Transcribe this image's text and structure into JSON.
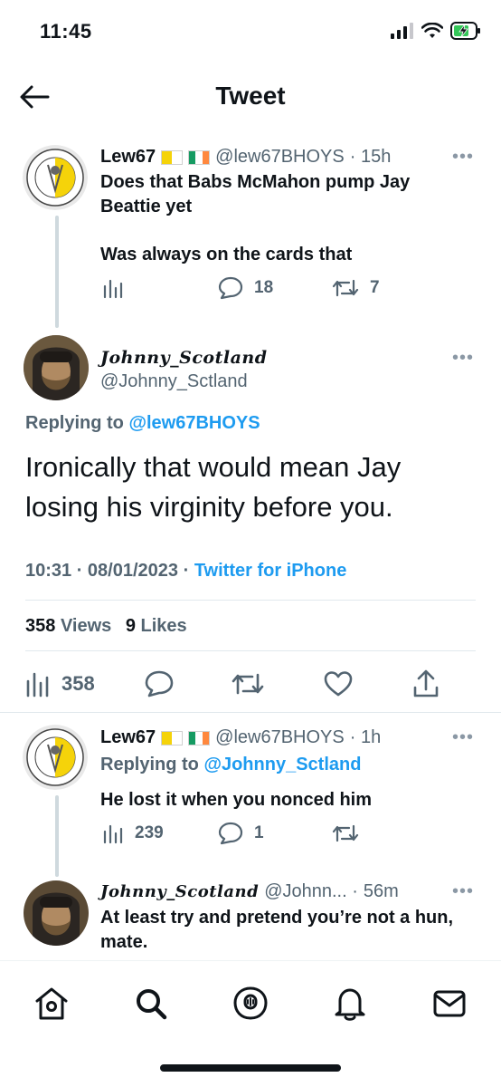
{
  "status_bar": {
    "time": "11:45"
  },
  "nav": {
    "title": "Tweet"
  },
  "parent_tweet": {
    "name": "Lew67",
    "handle": "@lew67BHOYS",
    "time": "· 15h",
    "text_line1": "Does that Babs McMahon pump Jay",
    "text_line2": "Beattie yet",
    "text_line3": "Was always on the cards that",
    "replies": "18",
    "retweets": "7"
  },
  "main_tweet": {
    "name": "Johnny_Scotland",
    "handle": "@Johnny_Sctland",
    "replying_prefix": "Replying to",
    "replying_handle": "@lew67BHOYS",
    "text_line1": "Ironically that would mean Jay",
    "text_line2": "losing his virginity before you.",
    "timestamp": "10:31 · 08/01/2023 ·",
    "client": "Twitter for iPhone",
    "views_count": "358",
    "views_label": "Views",
    "likes_count": "9",
    "likes_label": "Likes",
    "analytics_count": "358"
  },
  "reply1": {
    "name": "Lew67",
    "handle": "@lew67BHOYS",
    "time": "· 1h",
    "replying_prefix": "Replying to",
    "replying_handle": "@Johnny_Sctland",
    "text": "He lost it when you nonced him",
    "views": "239",
    "replies": "1"
  },
  "reply2": {
    "name": "Johnny_Scotland",
    "handle": "@Johnn... ·",
    "time": "56m",
    "text_line1": "At least try and pretend you’re not a hun,",
    "text_line2": "mate."
  },
  "colors": {
    "accent": "#1d9bf0",
    "secondary": "#536471",
    "divider": "#e1e8ed"
  }
}
